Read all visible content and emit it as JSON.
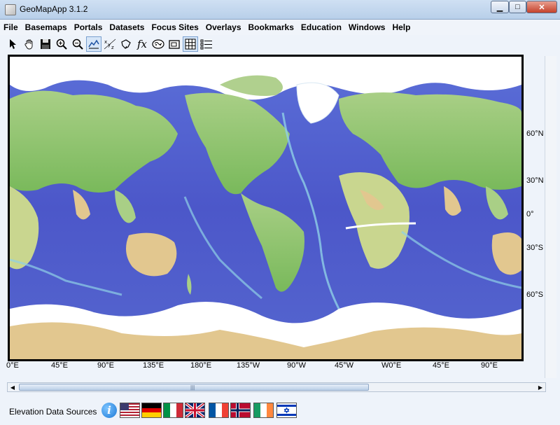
{
  "window": {
    "title": "GeoMapApp 3.1.2",
    "minimize": "▁",
    "maximize": "□",
    "close": "✕"
  },
  "menus": [
    "File",
    "Basemaps",
    "Portals",
    "Datasets",
    "Focus Sites",
    "Overlays",
    "Bookmarks",
    "Education",
    "Windows",
    "Help"
  ],
  "toolbar": {
    "icons": [
      "pointer-icon",
      "hand-pan-icon",
      "save-icon",
      "zoom-in-icon",
      "zoom-out-icon",
      "profile-icon",
      "xyz-icon",
      "lasso-icon",
      "function-icon",
      "globe-icon",
      "layers-icon",
      "grid-icon",
      "list-icon"
    ],
    "glyphs": [
      "↖",
      "✋",
      "💾",
      "⊕",
      "⊖",
      "⛰",
      "xyz",
      "☐",
      "fx",
      "◉",
      "▣",
      "▦",
      "☰"
    ],
    "function_label": "fx",
    "xyz_label": "xyz"
  },
  "map": {
    "lat_labels": [
      "60°N",
      "30°N",
      "0°",
      "30°S",
      "60°S"
    ],
    "lon_labels": [
      "0°E",
      "45°E",
      "90°E",
      "135°E",
      "180°E",
      "135°W",
      "90°W",
      "45°W",
      "W0°E",
      "45°E",
      "90°E"
    ]
  },
  "footer": {
    "label": "Elevation Data Sources",
    "info_glyph": "i",
    "flags": [
      "usa-flag",
      "germany-flag",
      "italy-flag",
      "uk-flag",
      "france-flag",
      "norway-flag",
      "ireland-flag",
      "israel-flag"
    ]
  },
  "colors": {
    "ocean_deep": "#4a55c8",
    "ocean_mid": "#5f7fd6",
    "shelf": "#8fd0e6",
    "land_low": "#8cc26a",
    "land_high": "#e0c48f",
    "ice": "#ffffff"
  }
}
